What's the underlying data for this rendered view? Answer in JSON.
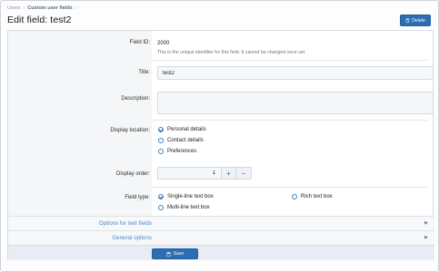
{
  "breadcrumb": {
    "item1": "Users",
    "item2": "Custom user fields",
    "sep": "›"
  },
  "page": {
    "title": "Edit field: test2"
  },
  "header": {
    "delete_label": "Delete"
  },
  "form": {
    "field_id": {
      "label": "Field ID:",
      "value": "2000",
      "hint": "This is the unique identifier for this field. It cannot be changed once set."
    },
    "title": {
      "label": "Title:",
      "value": "test2"
    },
    "description": {
      "label": "Description:",
      "value": ""
    },
    "display_location": {
      "label": "Display location:",
      "options": [
        "Personal details",
        "Contact details",
        "Preferences"
      ],
      "selected": "Personal details"
    },
    "display_order": {
      "label": "Display order:",
      "value": "1",
      "plus": "+",
      "minus": "−"
    },
    "field_type": {
      "label": "Field type:",
      "options": [
        "Single-line text box",
        "Multi-line text box",
        "Rich text box"
      ],
      "selected": "Single-line text box"
    },
    "sections": [
      "Options for text fields",
      "General options"
    ],
    "save_label": "Save"
  },
  "colors": {
    "accent": "#2d6db1",
    "link": "#4f87c4",
    "label_bg": "#f4f6f8"
  },
  "icons": {
    "delete": "trash-icon",
    "save": "floppy-icon",
    "chevron": "chevron-right-icon"
  }
}
